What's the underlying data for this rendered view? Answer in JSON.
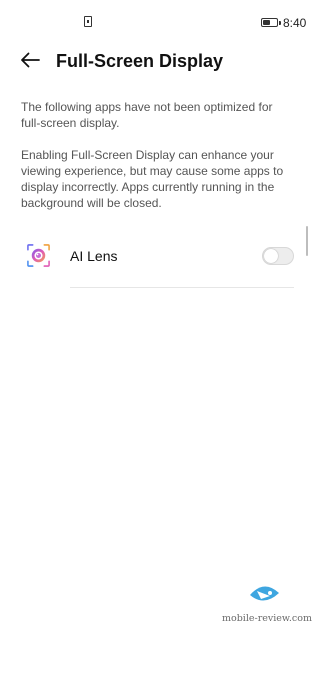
{
  "status_bar": {
    "time": "8:40",
    "icons": [
      "sim-card-icon",
      "battery-icon"
    ]
  },
  "header": {
    "title": "Full-Screen Display",
    "back_icon": "arrow-left-icon"
  },
  "description": {
    "paragraph_1": "The following apps have not been optimized for full-screen display.",
    "paragraph_2": "Enabling Full-Screen Display can enhance your viewing experience, but may cause some apps to display incorrectly. Apps currently running in the background will be closed."
  },
  "apps": [
    {
      "name": "AI Lens",
      "icon": "ai-lens-icon",
      "enabled": false
    }
  ],
  "watermark": {
    "text": "mobile-review.com",
    "logo": "mobile-review-logo"
  },
  "colors": {
    "accent_blue": "#3ea6e0",
    "text_primary": "#111111",
    "text_secondary": "#555555"
  }
}
